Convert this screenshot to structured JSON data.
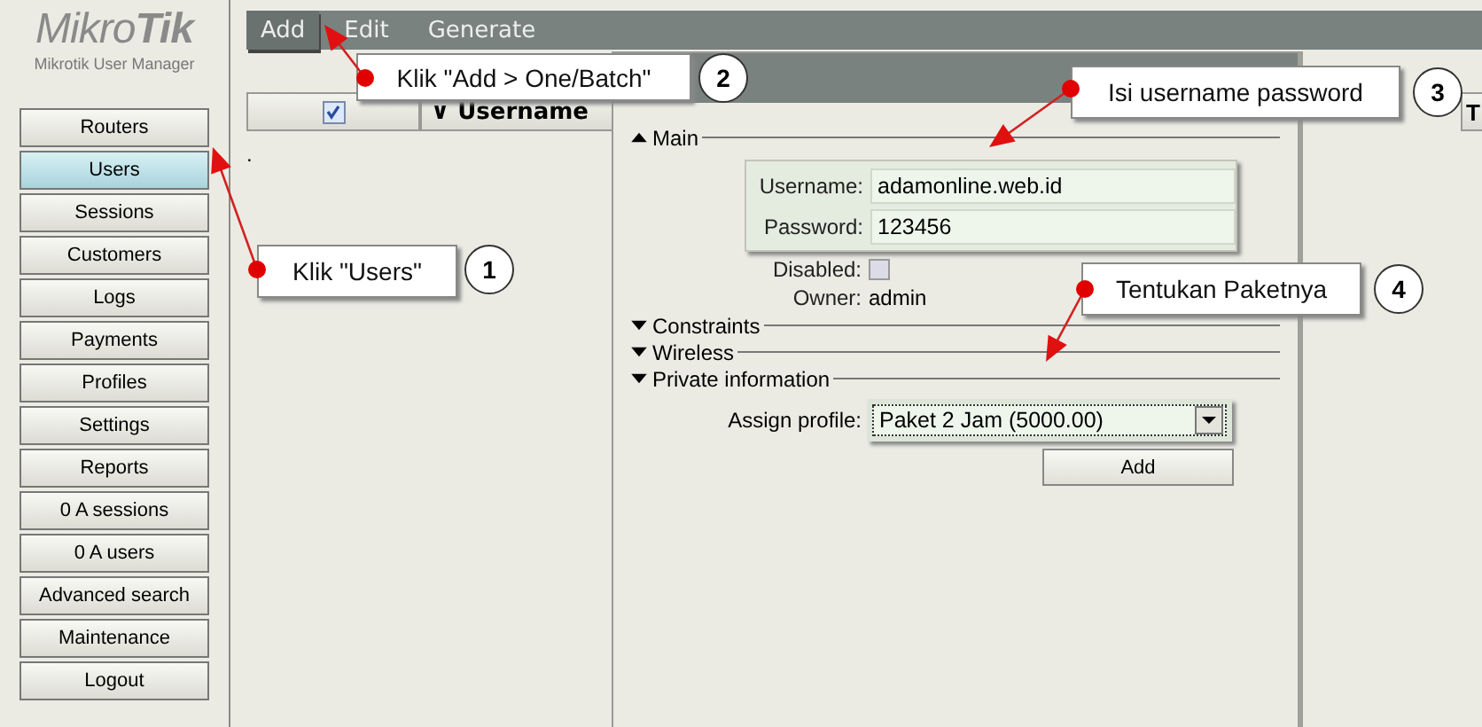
{
  "app": {
    "logo": "Mikro**Tik**",
    "subtitle": "Mikrotik User Manager"
  },
  "sidebar": {
    "items": [
      {
        "label": "Routers",
        "selected": false
      },
      {
        "label": "Users",
        "selected": true
      },
      {
        "label": "Sessions",
        "selected": false
      },
      {
        "label": "Customers",
        "selected": false
      },
      {
        "label": "Logs",
        "selected": false
      },
      {
        "label": "Payments",
        "selected": false
      },
      {
        "label": "Profiles",
        "selected": false
      },
      {
        "label": "Settings",
        "selected": false
      },
      {
        "label": "Reports",
        "selected": false
      },
      {
        "label": "0 A sessions",
        "selected": false
      },
      {
        "label": "0 A users",
        "selected": false
      },
      {
        "label": "Advanced search",
        "selected": false
      },
      {
        "label": "Maintenance",
        "selected": false
      },
      {
        "label": "Logout",
        "selected": false
      }
    ]
  },
  "menubar": {
    "items": [
      {
        "label": "Add",
        "selected": true
      },
      {
        "label": "Edit",
        "selected": false
      },
      {
        "label": "Generate",
        "selected": false
      }
    ]
  },
  "table": {
    "select_all_checked": true,
    "columns": [
      {
        "label": "∨ Username"
      },
      {
        "label": "T"
      }
    ],
    "rows": [
      {
        "column_1": "."
      }
    ]
  },
  "dialog": {
    "sections": [
      {
        "label": "Main",
        "expanded": true
      },
      {
        "label": "Constraints",
        "expanded": false
      },
      {
        "label": "Wireless",
        "expanded": false
      },
      {
        "label": "Private information",
        "expanded": false
      }
    ],
    "username": {
      "label": "Username:",
      "value": "adamonline.web.id"
    },
    "password": {
      "label": "Password:",
      "value": "123456"
    },
    "disabled": {
      "label": "Disabled:",
      "checked": false
    },
    "owner": {
      "label": "Owner:",
      "value": "admin"
    },
    "assign_profile": {
      "label": "Assign profile:",
      "value": "Paket 2 Jam (5000.00)"
    },
    "button": "Add"
  },
  "callouts": [
    {
      "number": "2",
      "text": "Klik \"Add > One/Batch\""
    },
    {
      "number": "3",
      "text": "Isi username password"
    },
    {
      "number": "1",
      "text": "Klik \"Users\""
    },
    {
      "number": "4",
      "text": "Tentukan Paketnya"
    }
  ]
}
